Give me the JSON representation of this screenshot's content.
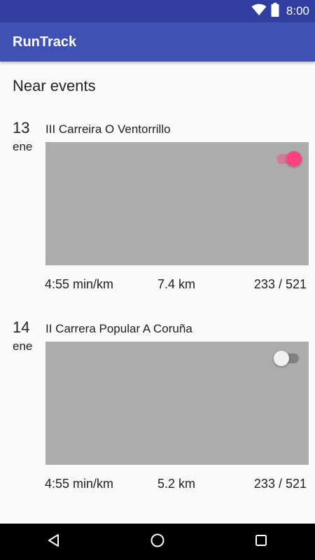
{
  "status_bar": {
    "time": "8:00"
  },
  "app_bar": {
    "title": "RunTrack",
    "color": "#3f51b5",
    "status_color": "#303f9f"
  },
  "section": {
    "title": "Near events"
  },
  "events": [
    {
      "day": "13",
      "month": "ene",
      "name": "III Carreira O Ventorrillo",
      "toggle_on": true,
      "pace": "4:55 min/km",
      "distance": "7.4 km",
      "position": "233 / 521"
    },
    {
      "day": "14",
      "month": "ene",
      "name": "II Carrera Popular A Coruña",
      "toggle_on": false,
      "pace": "4:55 min/km",
      "distance": "5.2 km",
      "position": "233 / 521"
    }
  ],
  "colors": {
    "accent": "#ff4081",
    "image_placeholder": "#acacac"
  },
  "icons": {
    "status": [
      "wifi-icon",
      "battery-icon"
    ],
    "nav": [
      "back-icon",
      "home-icon",
      "recents-icon"
    ]
  }
}
